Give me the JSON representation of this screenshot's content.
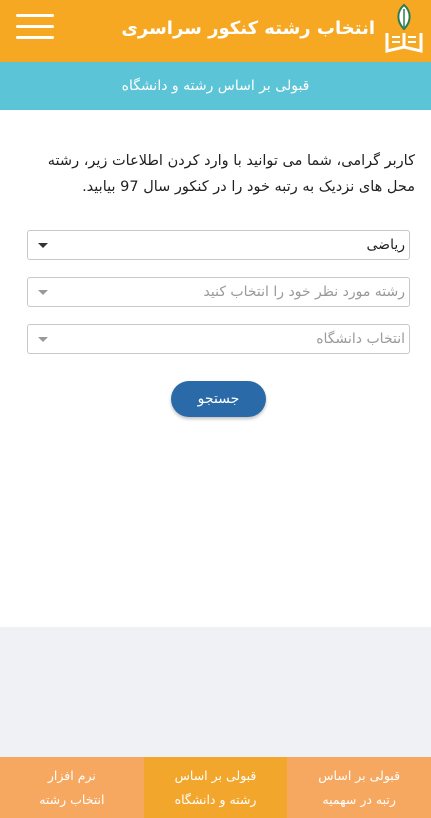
{
  "header": {
    "title": "انتخاب رشته کنکور سراسری",
    "brand_color": "#f7a823"
  },
  "subheader": {
    "text": "قبولی بر اساس رشته و دانشگاه",
    "color": "#5bc4d6"
  },
  "intro": {
    "text": "کاربر گرامی، شما می توانید با وارد کردن اطلاعات زیر، رشته محل های نزدیک به رتبه خود را در کنکور سال 97 بیابید."
  },
  "form": {
    "group_select": {
      "value": "ریاضی"
    },
    "major_select": {
      "placeholder": "رشته مورد نظر خود را انتخاب کنید"
    },
    "university_select": {
      "placeholder": "انتخاب دانشگاه"
    },
    "search_label": "جستجو",
    "search_color": "#2b6aa9"
  },
  "bottom_nav": {
    "tabs": [
      {
        "line1": "قبولی بر اساس",
        "line2": "رتبه در سهمیه",
        "active": false
      },
      {
        "line1": "قبولی بر اساس",
        "line2": "رشته و دانشگاه",
        "active": true
      },
      {
        "line1": "نرم افزار",
        "line2": "انتخاب رشته",
        "active": false
      }
    ]
  }
}
